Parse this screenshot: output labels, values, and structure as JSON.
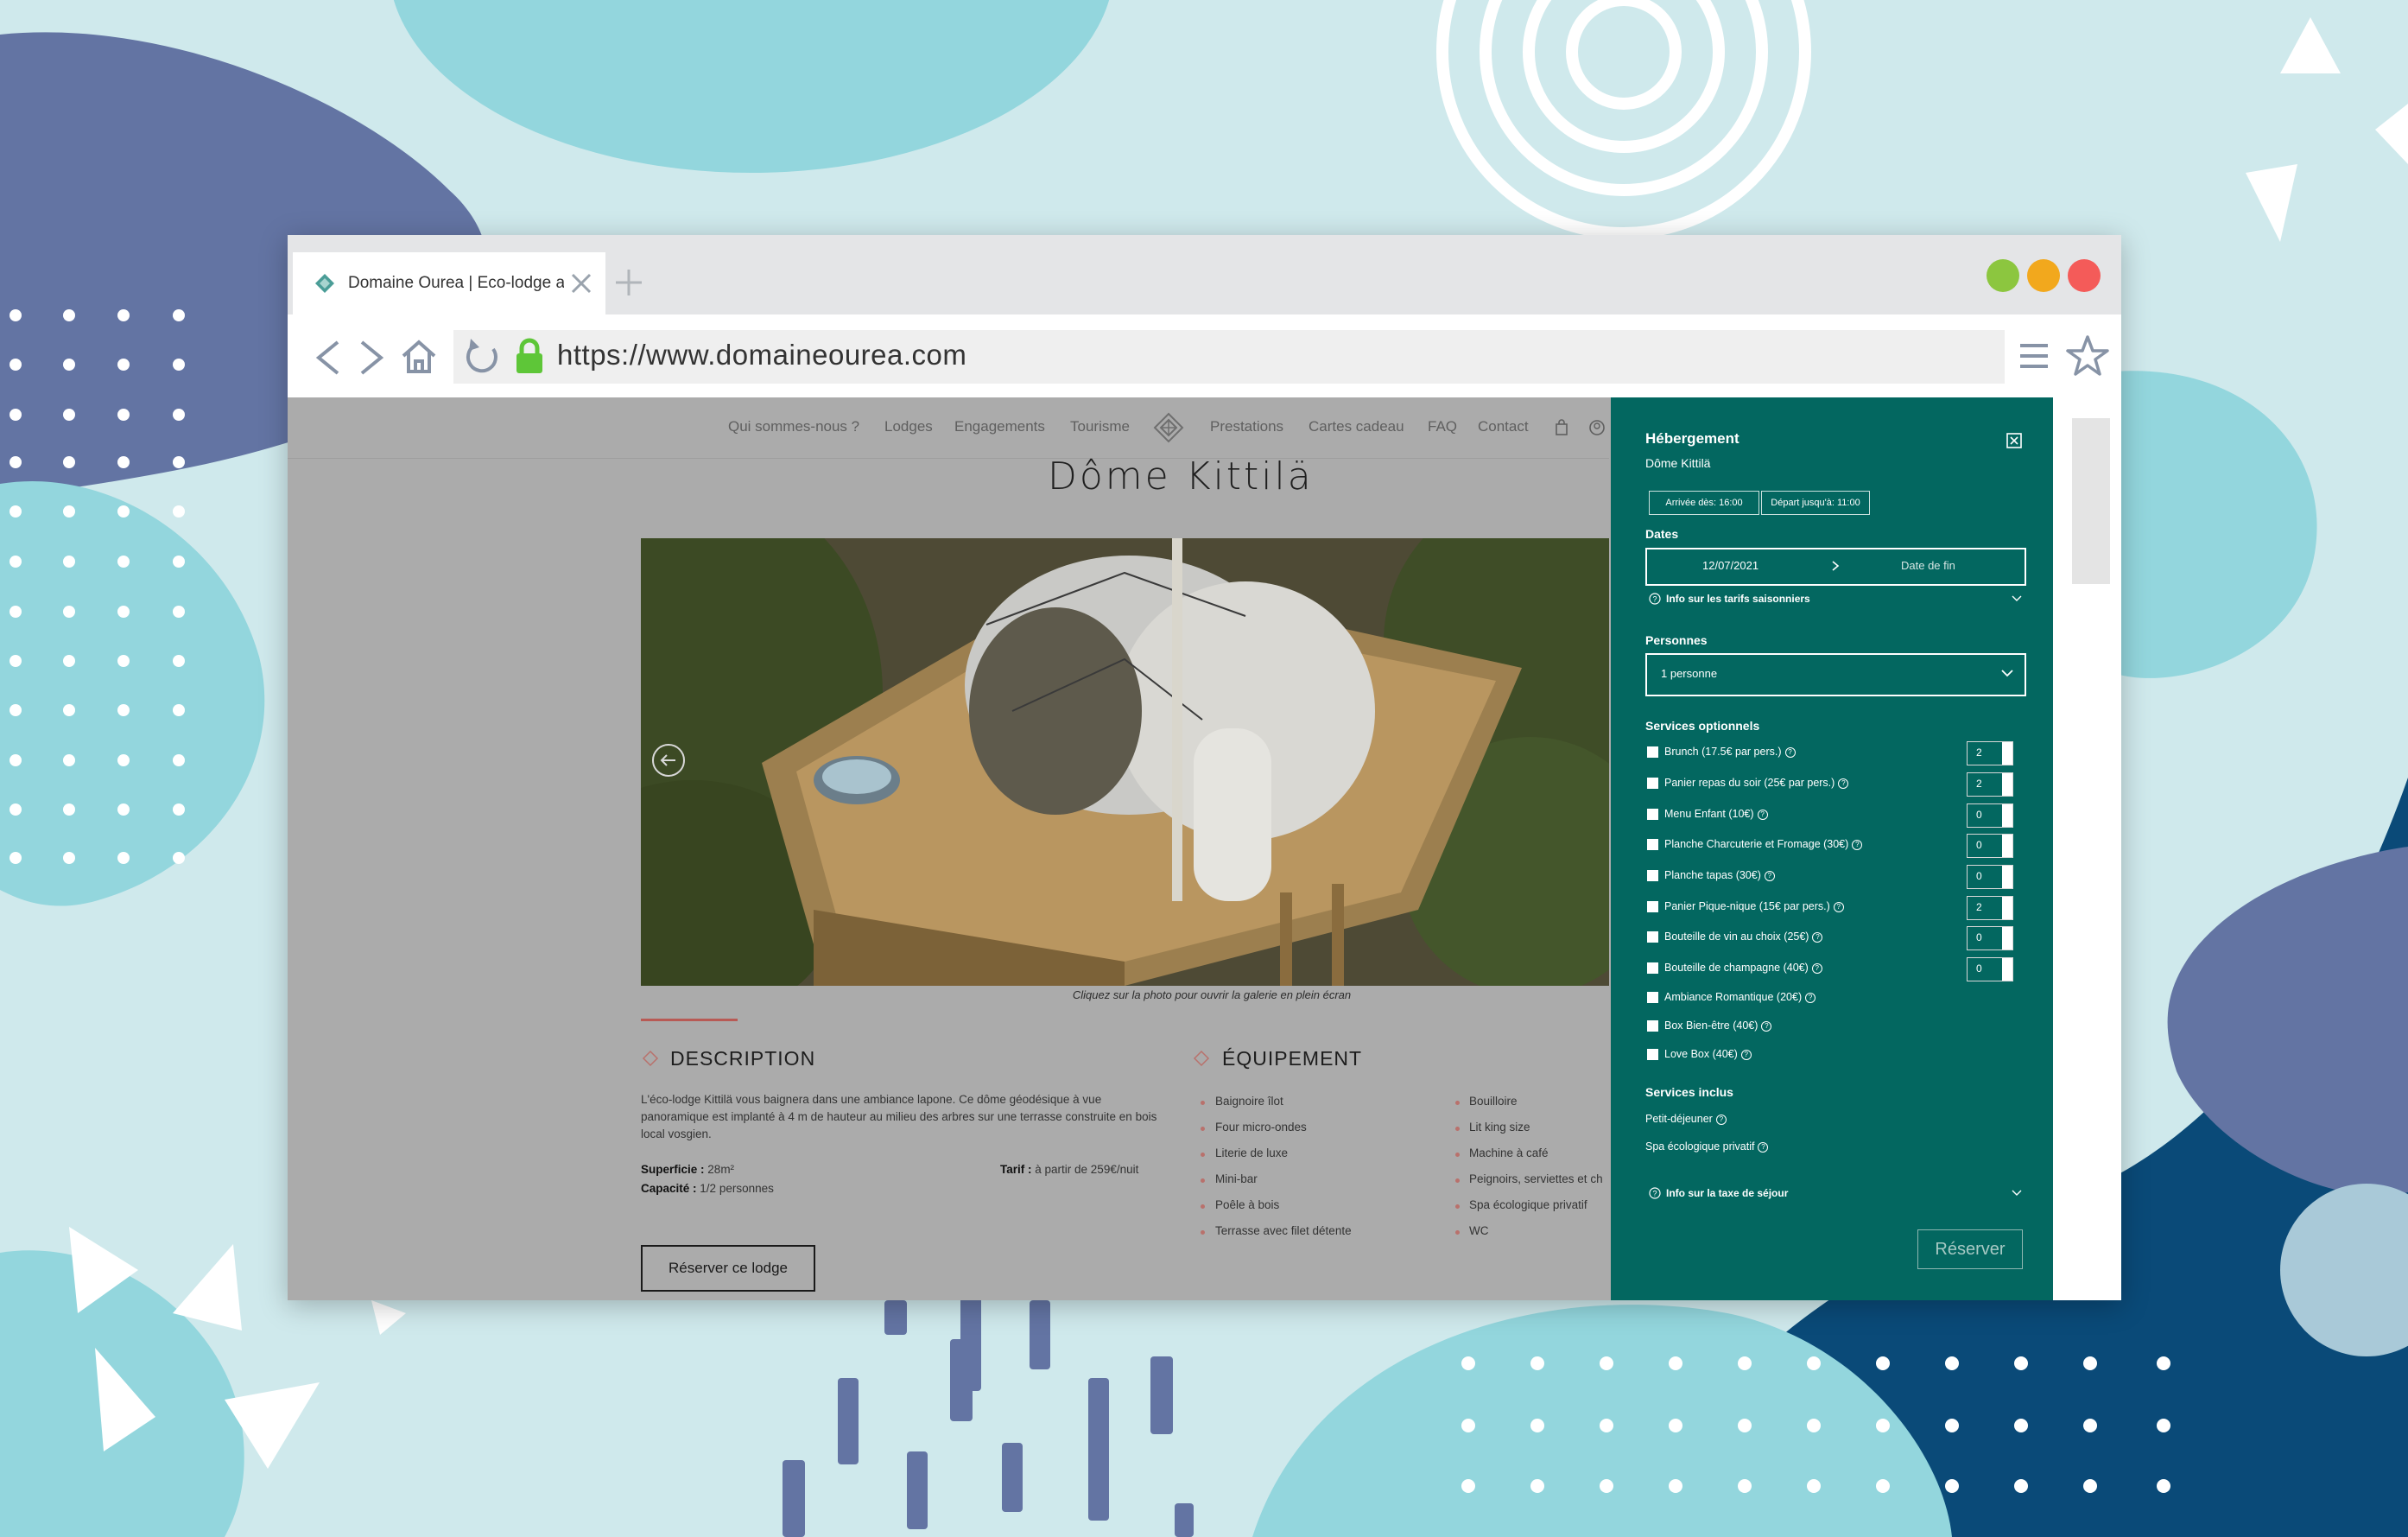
{
  "browser": {
    "tab_title": "Domaine Ourea | Eco-lodge a",
    "url": "https://www.domaineourea.com",
    "traffic_colors": [
      "#8cc63f",
      "#f2a81d",
      "#f45b59"
    ]
  },
  "site": {
    "nav": {
      "items": [
        "Qui sommes-nous ?",
        "Lodges",
        "Engagements",
        "Tourisme",
        "Prestations",
        "Cartes cadeau",
        "FAQ",
        "Contact"
      ]
    },
    "title": "Dôme Kittilä",
    "gallery_caption": "Cliquez sur la photo pour ouvrir la galerie en plein écran",
    "description": {
      "heading": "DESCRIPTION",
      "text": "L'éco-lodge Kittilä vous baignera dans une ambiance lapone. Ce dôme géodésique à vue panoramique est implanté à 4 m de hauteur au milieu des arbres sur une terrasse construite en bois local vosgien.",
      "superficie_label": "Superficie :",
      "superficie_value": "28m²",
      "capacite_label": "Capacité :",
      "capacite_value": "1/2 personnes",
      "tarif_label": "Tarif :",
      "tarif_value": "à partir de 259€/nuit"
    },
    "equipment": {
      "heading": "ÉQUIPEMENT",
      "col1": [
        "Baignoire îlot",
        "Four micro-ondes",
        "Literie de luxe",
        "Mini-bar",
        "Poêle à bois",
        "Terrasse avec filet détente"
      ],
      "col2": [
        "Bouilloire",
        "Lit king size",
        "Machine à café",
        "Peignoirs, serviettes et ch",
        "Spa écologique privatif",
        "WC"
      ]
    },
    "reserve_lodge_label": "Réserver ce lodge"
  },
  "booking": {
    "title": "Hébergement",
    "lodge_name": "Dôme Kittilä",
    "arrival": "Arrivée dès: 16:00",
    "departure": "Départ jusqu'à: 11:00",
    "dates_label": "Dates",
    "start_date": "12/07/2021",
    "end_date_placeholder": "Date de fin",
    "seasonal_info": "Info sur les tarifs saisonniers",
    "persons_label": "Personnes",
    "persons_value": "1 personne",
    "optional_label": "Services optionnels",
    "services": [
      {
        "label": "Brunch (17.5€ par pers.)",
        "qty": "2"
      },
      {
        "label": "Panier repas du soir (25€ par pers.)",
        "qty": "2"
      },
      {
        "label": "Menu Enfant (10€)",
        "qty": "0"
      },
      {
        "label": "Planche Charcuterie et Fromage (30€)",
        "qty": "0"
      },
      {
        "label": "Planche tapas (30€)",
        "qty": "0"
      },
      {
        "label": "Panier Pique-nique (15€ par pers.)",
        "qty": "2"
      },
      {
        "label": "Bouteille de vin au choix (25€)",
        "qty": "0"
      },
      {
        "label": "Bouteille de champagne (40€)",
        "qty": "0"
      }
    ],
    "extras": [
      "Ambiance Romantique (20€)",
      "Box Bien-être (40€)",
      "Love Box (40€)"
    ],
    "included_label": "Services inclus",
    "included": [
      "Petit-déjeuner",
      "Spa écologique privatif"
    ],
    "tax_info": "Info sur la taxe de séjour",
    "reserve_label": "Réserver"
  }
}
